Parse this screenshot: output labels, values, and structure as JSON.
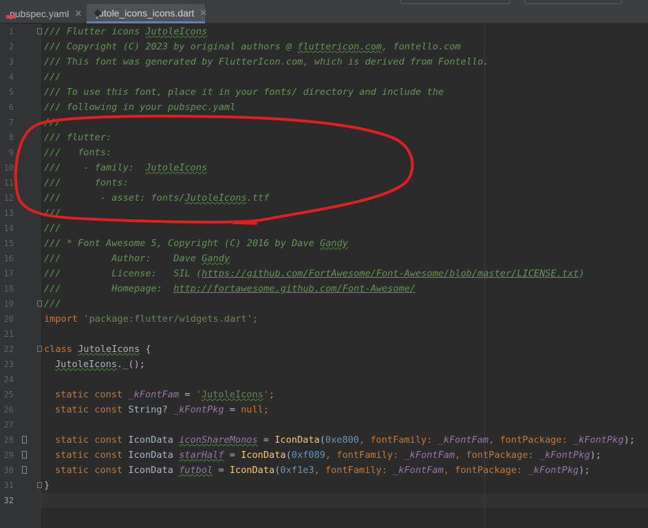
{
  "tabs": [
    {
      "label": "pubspec.yaml",
      "icon": "yaml-file-icon",
      "active": false
    },
    {
      "label": "jutole_icons_icons.dart",
      "icon": "dart-file-icon",
      "active": true
    }
  ],
  "editor": {
    "current_line": 32,
    "line_numbers": [
      "1",
      "2",
      "3",
      "4",
      "5",
      "6",
      "7",
      "8",
      "9",
      "10",
      "11",
      "12",
      "13",
      "14",
      "15",
      "16",
      "17",
      "18",
      "19",
      "20",
      "21",
      "22",
      "23",
      "24",
      "25",
      "26",
      "27",
      "28",
      "29",
      "30",
      "31",
      "32"
    ],
    "l1_a": "/// Flutter icons ",
    "l1_b": "JutoleIcons",
    "l2_a": "/// Copyright (C) 2023 by original authors @ ",
    "l2_b": "fluttericon.com",
    "l2_c": ", fontello.com",
    "l3": "/// This font was generated by FlutterIcon.com, which is derived from Fontello.",
    "l4": "///",
    "l5": "/// To use this font, place it in your fonts/ directory and include the",
    "l6": "/// following in your pubspec.yaml",
    "l7": "///",
    "l8": "/// flutter:",
    "l9": "///   fonts:",
    "l10_a": "///    - family:  ",
    "l10_b": "JutoleIcons",
    "l11": "///      fonts:",
    "l12_a": "///       - asset: fonts/",
    "l12_b": "JutoleIcons",
    "l12_c": ".ttf",
    "l13": "///",
    "l14": "///",
    "l15_a": "/// * Font Awesome 5, Copyright (C) 2016 by Dave ",
    "l15_b": "Gandy",
    "l16_a": "///         Author:    Dave ",
    "l16_b": "Gandy",
    "l17_a": "///         License:   SIL (",
    "l17_b": "https://github.com/FortAwesome/Font-Awesome/blob/master/LICENSE.txt",
    "l17_c": ")",
    "l18_a": "///         Homepage:  ",
    "l18_b": "http://fortawesome.github.com/Font-Awesome/",
    "l19": "///",
    "l20_kw": "import ",
    "l20_str": "'package:flutter/widgets.dart'",
    "l20_end": ";",
    "l22_kw": "class ",
    "l22_name": "JutoleIcons",
    "l22_end": " {",
    "l23_name": "JutoleIcons",
    "l23_rest": "._();",
    "static_kw": "static const ",
    "l25_var": "_kFontFam",
    "l25_eq": " = ",
    "l25_str1": "'",
    "l25_strw": "JutoleIcons",
    "l25_str2": "'",
    "l25_end": ";",
    "l26_type": "String? ",
    "l26_var": "_kFontPkg",
    "l26_eq": " = ",
    "l26_null": "null",
    "l26_end": ";",
    "icon_type": "IconData ",
    "icons": [
      {
        "name": "iconShareMonos",
        "code": "0xe800"
      },
      {
        "name": "starHalf",
        "code": "0xf089"
      },
      {
        "name": "futbol",
        "code": "0xf1e3"
      }
    ],
    "ctor": "IconData",
    "paren_open": "(",
    "comma_ff": ", fontFamily: ",
    "ff_var": "_kFontFam",
    "comma_fp": ", fontPackage: ",
    "fp_var": "_kFontPkg",
    "close_end": ");",
    "eq": " = ",
    "l31": "}"
  },
  "annotation_color": "#e02020"
}
